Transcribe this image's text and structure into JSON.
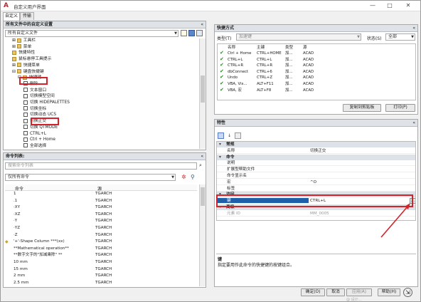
{
  "window": {
    "title": "自定义用户界面",
    "minimize": "—",
    "maximize": "□",
    "close": "✕"
  },
  "tabs": [
    "自定义",
    "传输"
  ],
  "left_top": {
    "header": "所有文件中的自定义设置",
    "chevron": "«",
    "combo_value": "所有自定义文件",
    "tree": [
      {
        "label": "工具栏",
        "indent": 1,
        "icon": "folder",
        "sign": "⊞"
      },
      {
        "label": "菜单",
        "indent": 1,
        "icon": "folder",
        "sign": "⊞"
      },
      {
        "label": "快捷特性",
        "indent": 1,
        "icon": "folder",
        "sign": ""
      },
      {
        "label": "鼠标悬停工具提示",
        "indent": 1,
        "icon": "folder",
        "sign": ""
      },
      {
        "label": "快捷菜单",
        "indent": 1,
        "icon": "folder",
        "sign": "⊞"
      },
      {
        "label": "键盘快捷键",
        "indent": 1,
        "icon": "folder",
        "sign": "⊟"
      },
      {
        "label": "快捷键",
        "indent": 2,
        "icon": "folder",
        "sign": "⊟"
      },
      {
        "label": "删除",
        "indent": 3,
        "icon": "key",
        "sign": ""
      },
      {
        "label": "文本窗口",
        "indent": 3,
        "icon": "key",
        "sign": ""
      },
      {
        "label": "切换模型空间",
        "indent": 3,
        "icon": "key",
        "sign": ""
      },
      {
        "label": "切换 HIDEPALETTES",
        "indent": 3,
        "icon": "key",
        "sign": ""
      },
      {
        "label": "切换坐标",
        "indent": 3,
        "icon": "key",
        "sign": ""
      },
      {
        "label": "切换动态 UCS",
        "indent": 3,
        "icon": "key",
        "sign": ""
      },
      {
        "label": "切换正交",
        "indent": 3,
        "icon": "key",
        "sign": ""
      },
      {
        "label": "切换 QTMODE",
        "indent": 3,
        "icon": "key",
        "sign": ""
      },
      {
        "label": "CTRL+L",
        "indent": 3,
        "icon": "key",
        "sign": ""
      },
      {
        "label": "Ctrl + Home",
        "indent": 3,
        "icon": "key",
        "sign": ""
      },
      {
        "label": "全部选择",
        "indent": 3,
        "icon": "key",
        "sign": ""
      }
    ]
  },
  "left_bottom": {
    "header": "命令列表:",
    "chevron": "«",
    "search_placeholder": "搜索命令列表",
    "filter_value": "仅所有命令",
    "col_command": "命令",
    "col_source": "源",
    "commands": [
      {
        "name": "1",
        "src": "TGARCH"
      },
      {
        "name": ".1",
        "src": "TGARCH"
      },
      {
        "name": "·XY",
        "src": "TGARCH"
      },
      {
        "name": "·XZ",
        "src": "TGARCH"
      },
      {
        "name": "·Y",
        "src": "TGARCH"
      },
      {
        "name": "·YZ",
        "src": "TGARCH"
      },
      {
        "name": "·Z",
        "src": "TGARCH"
      },
      {
        "name": "'+'-Shape Column    ***(xx)",
        "src": "TGARCH"
      },
      {
        "name": "**Mathematical operation**",
        "src": "TGARCH"
      },
      {
        "name": "**数字文字的\"加减乘除\" **",
        "src": "TGARCH"
      },
      {
        "name": "10    mm",
        "src": "TGARCH"
      },
      {
        "name": "15    mm",
        "src": "TGARCH"
      },
      {
        "name": "2     mm",
        "src": "TGARCH"
      },
      {
        "name": "2.5   mm",
        "src": "TGARCH"
      }
    ]
  },
  "shortcuts": {
    "header": "快捷方式",
    "chevron": "«",
    "type_label": "类型(T)",
    "type_value": "加速键",
    "status_label": "状态(S)",
    "status_value": "全部",
    "columns": [
      "名称",
      "主键",
      "类型",
      "源"
    ],
    "rows": [
      [
        "Ctrl + Home",
        "CTRL+HOME",
        "加...",
        "ACAD"
      ],
      [
        "CTRL+L",
        "CTRL+L",
        "加...",
        "ACAD"
      ],
      [
        "CTRL+R",
        "CTRL+R",
        "加...",
        "ACAD"
      ],
      [
        "dbConnect",
        "CTRL+6",
        "加...",
        "ACAD"
      ],
      [
        "Undo",
        "CTRL+Z",
        "加...",
        "ACAD"
      ],
      [
        "VBA, Vis...",
        "ALT+F11",
        "加...",
        "ACAD"
      ],
      [
        "VBA, 宏",
        "ALT+F8",
        "加...",
        "ACAD"
      ]
    ],
    "copy_button": "复制到剪贴板",
    "print_button": "打印(P)"
  },
  "properties": {
    "header": "特性",
    "chevron": "«",
    "sections": [
      {
        "title": "常规",
        "rows": [
          [
            "名称",
            "切换正交"
          ]
        ]
      },
      {
        "title": "命令",
        "rows": [
          [
            "说明",
            ""
          ],
          [
            "扩展型帮助文件",
            ""
          ],
          [
            "命令显示名",
            ""
          ],
          [
            "宏",
            "^O"
          ],
          [
            "标签",
            ""
          ]
        ]
      },
      {
        "title": "访问",
        "rows": [
          [
            "键",
            "CTRL+L"
          ]
        ]
      },
      {
        "title": "高级",
        "rows": [
          [
            "元素 ID",
            "MM_0005"
          ]
        ]
      }
    ],
    "ellipsis": "...",
    "desc_title": "键",
    "desc_text": "指定要用作此命令的快捷键的按键组合。"
  },
  "footer": {
    "ok": "确定(O)",
    "cancel": "取消",
    "apply": "应用(A)",
    "help": "帮助(H)",
    "watermark": "@ 设计..."
  }
}
